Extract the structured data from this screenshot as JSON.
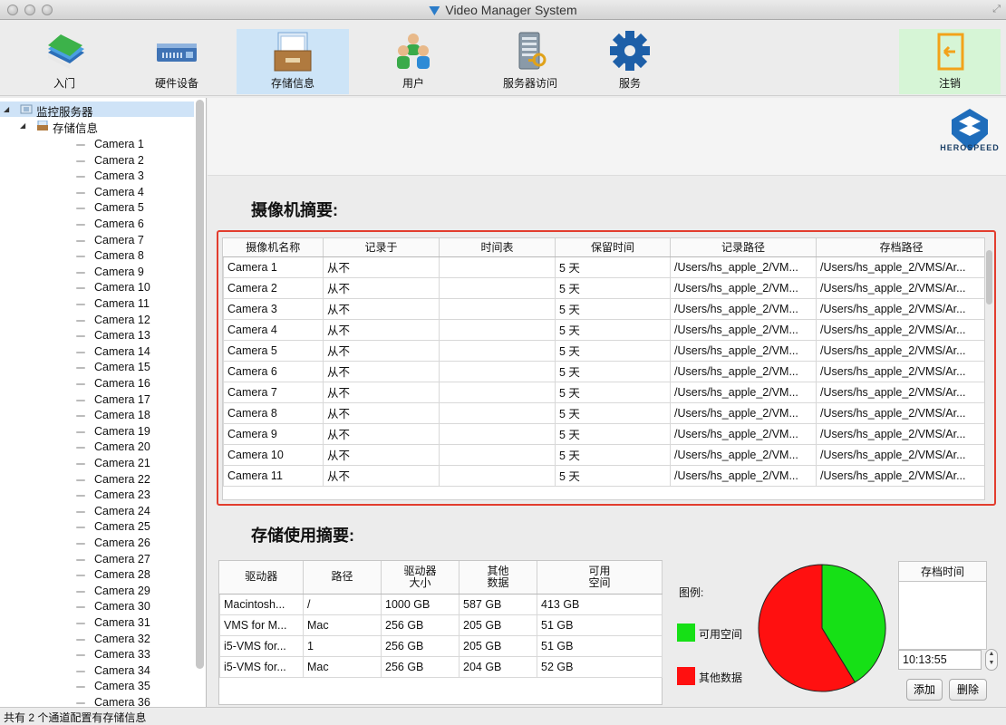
{
  "window": {
    "title": "Video Manager System"
  },
  "toolbar": [
    {
      "label": "入门",
      "icon": "books-icon"
    },
    {
      "label": "硬件设备",
      "icon": "hardware-device-icon"
    },
    {
      "label": "存储信息",
      "icon": "storage-drawer-icon",
      "active": true
    },
    {
      "label": "用户",
      "icon": "users-icon"
    },
    {
      "label": "服务器访问",
      "icon": "server-key-icon"
    },
    {
      "label": "服务",
      "icon": "gear-icon"
    },
    {
      "label": "注销",
      "icon": "logout-door-icon"
    }
  ],
  "tree": {
    "root": "监控服务器",
    "storage": "存储信息",
    "cameras": [
      "Camera 1",
      "Camera 2",
      "Camera 3",
      "Camera 4",
      "Camera 5",
      "Camera 6",
      "Camera 7",
      "Camera 8",
      "Camera 9",
      "Camera 10",
      "Camera 11",
      "Camera 12",
      "Camera 13",
      "Camera 14",
      "Camera 15",
      "Camera 16",
      "Camera 17",
      "Camera 18",
      "Camera 19",
      "Camera 20",
      "Camera 21",
      "Camera 22",
      "Camera 23",
      "Camera 24",
      "Camera 25",
      "Camera 26",
      "Camera 27",
      "Camera 28",
      "Camera 29",
      "Camera 30",
      "Camera 31",
      "Camera 32",
      "Camera 33",
      "Camera 34",
      "Camera 35",
      "Camera 36"
    ]
  },
  "brand": {
    "name": "HEROSPEED"
  },
  "camera_summary": {
    "title": "摄像机摘要:",
    "columns": [
      "摄像机名称",
      "记录于",
      "时间表",
      "保留时间",
      "记录路径",
      "存档路径"
    ],
    "rows": [
      [
        "Camera 1",
        "从不",
        "",
        "5 天",
        "/Users/hs_apple_2/VM...",
        "/Users/hs_apple_2/VMS/Ar..."
      ],
      [
        "Camera 2",
        "从不",
        "",
        "5 天",
        "/Users/hs_apple_2/VM...",
        "/Users/hs_apple_2/VMS/Ar..."
      ],
      [
        "Camera 3",
        "从不",
        "",
        "5 天",
        "/Users/hs_apple_2/VM...",
        "/Users/hs_apple_2/VMS/Ar..."
      ],
      [
        "Camera 4",
        "从不",
        "",
        "5 天",
        "/Users/hs_apple_2/VM...",
        "/Users/hs_apple_2/VMS/Ar..."
      ],
      [
        "Camera 5",
        "从不",
        "",
        "5 天",
        "/Users/hs_apple_2/VM...",
        "/Users/hs_apple_2/VMS/Ar..."
      ],
      [
        "Camera 6",
        "从不",
        "",
        "5 天",
        "/Users/hs_apple_2/VM...",
        "/Users/hs_apple_2/VMS/Ar..."
      ],
      [
        "Camera 7",
        "从不",
        "",
        "5 天",
        "/Users/hs_apple_2/VM...",
        "/Users/hs_apple_2/VMS/Ar..."
      ],
      [
        "Camera 8",
        "从不",
        "",
        "5 天",
        "/Users/hs_apple_2/VM...",
        "/Users/hs_apple_2/VMS/Ar..."
      ],
      [
        "Camera 9",
        "从不",
        "",
        "5 天",
        "/Users/hs_apple_2/VM...",
        "/Users/hs_apple_2/VMS/Ar..."
      ],
      [
        "Camera 10",
        "从不",
        "",
        "5 天",
        "/Users/hs_apple_2/VM...",
        "/Users/hs_apple_2/VMS/Ar..."
      ],
      [
        "Camera 11",
        "从不",
        "",
        "5 天",
        "/Users/hs_apple_2/VM...",
        "/Users/hs_apple_2/VMS/Ar..."
      ]
    ]
  },
  "storage_summary": {
    "title": "存储使用摘要:",
    "columns": [
      "驱动器",
      "路径",
      "驱动器\n大小",
      "其他\n数据",
      "可用\n空间"
    ],
    "rows": [
      [
        "Macintosh...",
        "/",
        "1000 GB",
        "587 GB",
        "413 GB"
      ],
      [
        "VMS for M...",
        "Mac",
        "256 GB",
        "205 GB",
        "51 GB"
      ],
      [
        "i5-VMS for...",
        "1",
        "256 GB",
        "205 GB",
        "51 GB"
      ],
      [
        "i5-VMS for...",
        "Mac",
        "256 GB",
        "204 GB",
        "52 GB"
      ]
    ]
  },
  "legend": {
    "title": "图例:",
    "items": [
      {
        "label": "可用空间",
        "color": "#16e016"
      },
      {
        "label": "其他数据",
        "color": "#ff1010"
      }
    ]
  },
  "pie": {
    "free_fraction": 0.413,
    "other_fraction": 0.587
  },
  "archive": {
    "header": "存档时间",
    "time_value": "10:13:55",
    "add_label": "添加",
    "delete_label": "删除"
  },
  "status": {
    "text": "共有 2 个通道配置有存储信息"
  }
}
